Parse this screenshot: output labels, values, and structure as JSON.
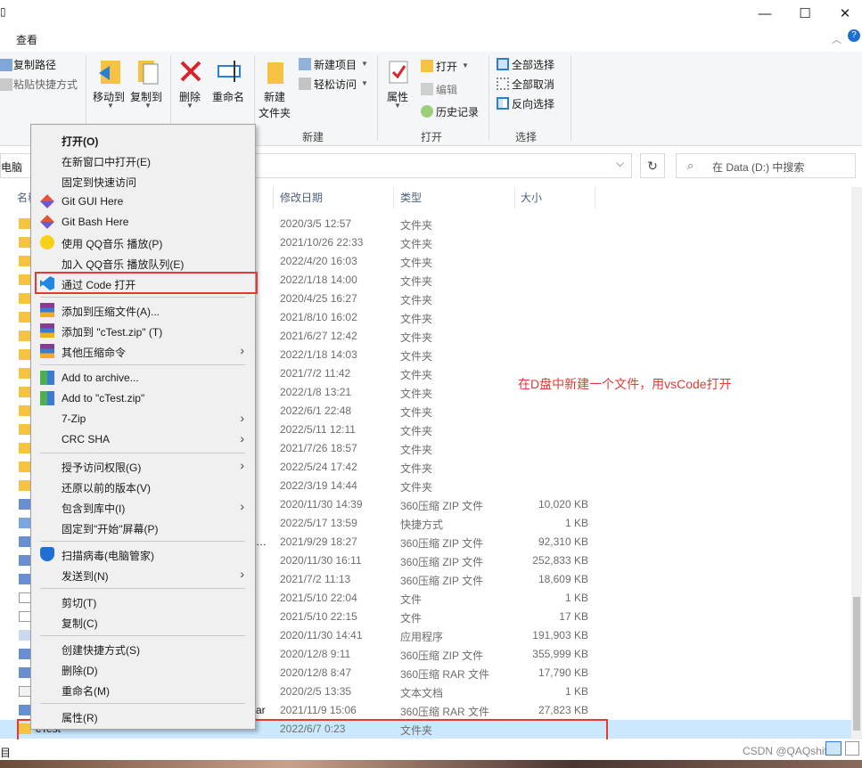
{
  "window": {
    "minimize": "—",
    "maximize": "☐",
    "close": "✕"
  },
  "ribbon": {
    "tab_view": "查看",
    "copy_path": "复制路径",
    "paste_shortcut": "粘贴快捷方式",
    "move_to": "移动到",
    "copy_to": "复制到",
    "delete": "删除",
    "rename": "重命名",
    "new_folder_1": "新建",
    "new_folder_2": "文件夹",
    "new_item": "新建项目",
    "easy_access": "轻松访问",
    "group_new": "新建",
    "properties": "属性",
    "open": "打开",
    "edit": "编辑",
    "history": "历史记录",
    "group_open": "打开",
    "select_all": "全部选择",
    "select_none": "全部取消",
    "invert_selection": "反向选择",
    "group_select": "选择"
  },
  "address": {
    "path": "电脑",
    "search_placeholder": "在 Data (D:) 中搜索"
  },
  "columns": {
    "name": "名称",
    "date": "修改日期",
    "type": "类型",
    "size": "大小"
  },
  "files": [
    {
      "name": "",
      "date": "2020/3/5 12:57",
      "type": "文件夹",
      "size": "",
      "icon": "folder"
    },
    {
      "name": "",
      "date": "2021/10/26 22:33",
      "type": "文件夹",
      "size": "",
      "icon": "folder"
    },
    {
      "name": "",
      "date": "2022/4/20 16:03",
      "type": "文件夹",
      "size": "",
      "icon": "folder"
    },
    {
      "name": "",
      "date": "2022/1/18 14:00",
      "type": "文件夹",
      "size": "",
      "icon": "folder"
    },
    {
      "name": "",
      "date": "2020/4/25 16:27",
      "type": "文件夹",
      "size": "",
      "icon": "folder"
    },
    {
      "name": "",
      "date": "2021/8/10 16:02",
      "type": "文件夹",
      "size": "",
      "icon": "folder"
    },
    {
      "name": "",
      "date": "2021/6/27 12:42",
      "type": "文件夹",
      "size": "",
      "icon": "folder"
    },
    {
      "name": "",
      "date": "2022/1/18 14:03",
      "type": "文件夹",
      "size": "",
      "icon": "folder"
    },
    {
      "name": "",
      "date": "2021/7/2 11:42",
      "type": "文件夹",
      "size": "",
      "icon": "folder"
    },
    {
      "name": "",
      "date": "2022/1/8 13:21",
      "type": "文件夹",
      "size": "",
      "icon": "folder"
    },
    {
      "name": "",
      "date": "2022/6/1 22:48",
      "type": "文件夹",
      "size": "",
      "icon": "folder"
    },
    {
      "name": "",
      "date": "2022/5/11 12:11",
      "type": "文件夹",
      "size": "",
      "icon": "folder"
    },
    {
      "name": "",
      "date": "2021/7/26 18:57",
      "type": "文件夹",
      "size": "",
      "icon": "folder"
    },
    {
      "name": "",
      "date": "2022/5/24 17:42",
      "type": "文件夹",
      "size": "",
      "icon": "folder"
    },
    {
      "name": "",
      "date": "2022/3/19 14:44",
      "type": "文件夹",
      "size": "",
      "icon": "folder"
    },
    {
      "name": "",
      "date": "2020/11/30 14:39",
      "type": "360压缩 ZIP 文件",
      "size": "10,020 KB",
      "icon": "archive"
    },
    {
      "name": "",
      "date": "2022/5/17 13:59",
      "type": "快捷方式",
      "size": "1 KB",
      "icon": "shortcut"
    },
    {
      "name": "…",
      "date": "2021/9/29 18:27",
      "type": "360压缩 ZIP 文件",
      "size": "92,310 KB",
      "icon": "archive"
    },
    {
      "name": "",
      "date": "2020/11/30 16:11",
      "type": "360压缩 ZIP 文件",
      "size": "252,833 KB",
      "icon": "archive"
    },
    {
      "name": "",
      "date": "2021/7/2 11:13",
      "type": "360压缩 ZIP 文件",
      "size": "18,609 KB",
      "icon": "archive"
    },
    {
      "name": "",
      "date": "2021/5/10 22:04",
      "type": "文件",
      "size": "1 KB",
      "icon": "file"
    },
    {
      "name": "",
      "date": "2021/5/10 22:15",
      "type": "文件",
      "size": "17 KB",
      "icon": "file"
    },
    {
      "name": "",
      "date": "2020/11/30 14:41",
      "type": "应用程序",
      "size": "191,903 KB",
      "icon": "app"
    },
    {
      "name": "",
      "date": "2020/12/8 9:11",
      "type": "360压缩 ZIP 文件",
      "size": "355,999 KB",
      "icon": "archive"
    },
    {
      "name": "",
      "date": "2020/12/8 8:47",
      "type": "360压缩 RAR 文件",
      "size": "17,790 KB",
      "icon": "archive"
    },
    {
      "name": "",
      "date": "2020/2/5 13:35",
      "type": "文本文档",
      "size": "1 KB",
      "icon": "text"
    },
    {
      "name": "ar",
      "date": "2021/11/9 15:06",
      "type": "360压缩 RAR 文件",
      "size": "27,823 KB",
      "icon": "archive"
    },
    {
      "name": "cTest",
      "date": "2022/6/7 0:23",
      "type": "文件夹",
      "size": "",
      "icon": "folder",
      "selected": true
    }
  ],
  "menu": [
    {
      "label": "打开(O)",
      "bold": true
    },
    {
      "label": "在新窗口中打开(E)"
    },
    {
      "label": "固定到快速访问"
    },
    {
      "label": "Git GUI Here",
      "icon": "git-icon"
    },
    {
      "label": "Git Bash Here",
      "icon": "git-icon"
    },
    {
      "label": "使用 QQ音乐 播放(P)",
      "icon": "qqmusic-icon"
    },
    {
      "label": "加入 QQ音乐 播放队列(E)"
    },
    {
      "label": "通过 Code 打开",
      "icon": "vscode-icon",
      "highlight": true
    },
    {
      "sep": true
    },
    {
      "label": "添加到压缩文件(A)...",
      "icon": "winrar-icon"
    },
    {
      "label": "添加到 \"cTest.zip\" (T)",
      "icon": "winrar-icon"
    },
    {
      "label": "其他压缩命令",
      "icon": "winrar-icon",
      "submenu": true
    },
    {
      "sep": true
    },
    {
      "label": "Add to archive...",
      "icon": "archive-icon"
    },
    {
      "label": "Add to \"cTest.zip\"",
      "icon": "archive-icon"
    },
    {
      "label": "7-Zip",
      "submenu": true
    },
    {
      "label": "CRC SHA",
      "submenu": true
    },
    {
      "sep": true
    },
    {
      "label": "授予访问权限(G)",
      "submenu": true
    },
    {
      "label": "还原以前的版本(V)"
    },
    {
      "label": "包含到库中(I)",
      "submenu": true
    },
    {
      "label": "固定到\"开始\"屏幕(P)"
    },
    {
      "sep": true
    },
    {
      "label": "扫描病毒(电脑管家)",
      "icon": "shield-icon"
    },
    {
      "label": "发送到(N)",
      "submenu": true
    },
    {
      "sep": true
    },
    {
      "label": "剪切(T)"
    },
    {
      "label": "复制(C)"
    },
    {
      "sep": true
    },
    {
      "label": "创建快捷方式(S)"
    },
    {
      "label": "删除(D)"
    },
    {
      "label": "重命名(M)"
    },
    {
      "sep": true
    },
    {
      "label": "属性(R)"
    }
  ],
  "annotation": "在D盘中新建一个文件，用vsCode打开",
  "statusbar": {
    "left": "目",
    "watermark": "CSDN @QAQshift"
  },
  "colors": {
    "accent": "#0078d7",
    "annotation_red": "#e53935",
    "selected_row": "#cce8ff"
  }
}
